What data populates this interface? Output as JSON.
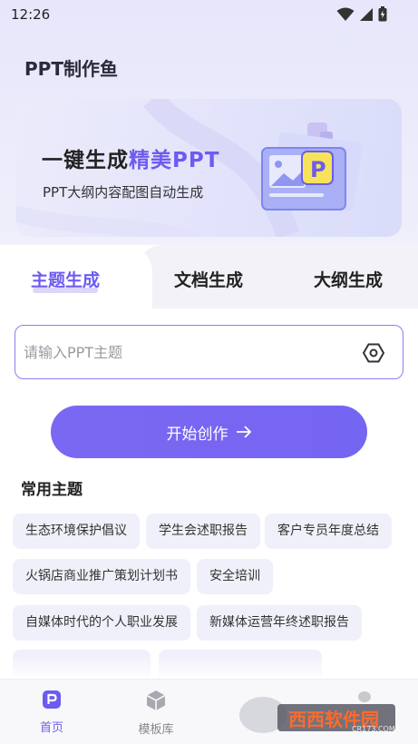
{
  "status_bar": {
    "time": "12:26"
  },
  "app_title": "PPT制作鱼",
  "banner": {
    "headline_prefix": "一键生成",
    "headline_accent": "精美PPT",
    "subtitle": "PPT大纲内容配图自动生成"
  },
  "tabs": [
    {
      "label": "主题生成",
      "active": true
    },
    {
      "label": "文档生成",
      "active": false
    },
    {
      "label": "大纲生成",
      "active": false
    }
  ],
  "search": {
    "placeholder": "请输入PPT主题",
    "value": ""
  },
  "start_button": {
    "label": "开始创作"
  },
  "common_topics": {
    "title": "常用主题",
    "items": [
      "生态环境保护倡议",
      "学生会述职报告",
      "客户专员年度总结",
      "火锅店商业推广策划计划书",
      "安全培训",
      "自媒体时代的个人职业发展",
      "新媒体运营年终述职报告",
      "…",
      "…"
    ]
  },
  "bottom_nav": [
    {
      "label": "首页",
      "icon": "home-p-icon",
      "active": true
    },
    {
      "label": "模板库",
      "icon": "cube-icon",
      "active": false
    }
  ],
  "watermark": {
    "text": "西西软件园",
    "sub": "CR173.COM"
  },
  "colors": {
    "accent": "#6c5cf0",
    "button": "#7566f2",
    "chip_bg": "#f0f0fb"
  }
}
